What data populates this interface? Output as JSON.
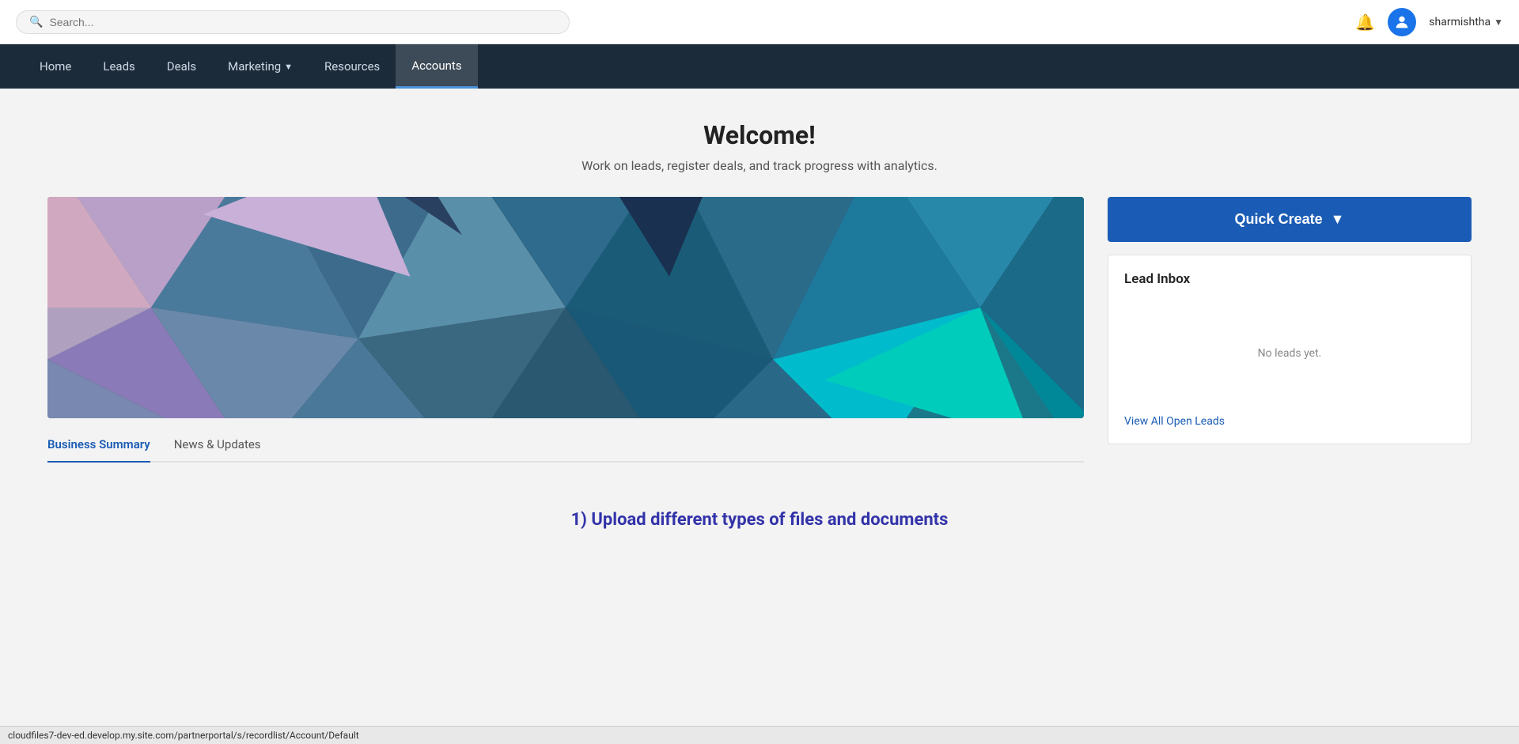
{
  "topbar": {
    "search_placeholder": "Search...",
    "user_name": "sharmishtha",
    "dropdown_arrow": "▼"
  },
  "navbar": {
    "items": [
      {
        "label": "Home",
        "active": false,
        "has_chevron": false
      },
      {
        "label": "Leads",
        "active": false,
        "has_chevron": false
      },
      {
        "label": "Deals",
        "active": false,
        "has_chevron": false
      },
      {
        "label": "Marketing",
        "active": false,
        "has_chevron": true
      },
      {
        "label": "Resources",
        "active": false,
        "has_chevron": false
      },
      {
        "label": "Accounts",
        "active": true,
        "has_chevron": false
      }
    ]
  },
  "welcome": {
    "title": "Welcome!",
    "subtitle": "Work on leads, register deals, and track progress with analytics."
  },
  "tabs": {
    "items": [
      {
        "label": "Business Summary",
        "active": true
      },
      {
        "label": "News & Updates",
        "active": false
      }
    ]
  },
  "quick_create": {
    "label": "Quick Create",
    "arrow": "▼"
  },
  "lead_inbox": {
    "title": "Lead Inbox",
    "empty_message": "No leads yet.",
    "view_all_label": "View All Open Leads"
  },
  "bottom": {
    "upload_title": "1) Upload different types of files and documents"
  },
  "status_bar": {
    "url": "cloudfiles7-dev-ed.develop.my.site.com/partnerportal/s/recordlist/Account/Default"
  },
  "icons": {
    "search": "🔍",
    "bell": "🔔",
    "user": "👤",
    "chevron_down": "▾"
  }
}
